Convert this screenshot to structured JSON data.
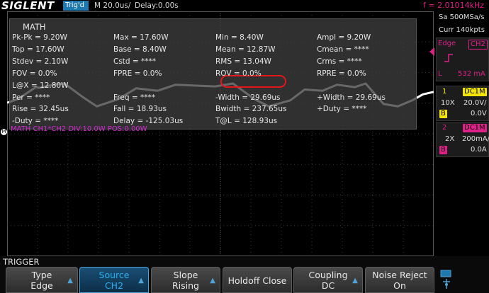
{
  "topbar": {
    "brand": "SIGLENT",
    "trigger_state": "Trig'd",
    "timebase": "M 20.0us/",
    "delay": "Delay:0.00s",
    "frequency": "f = 2.01014kHz"
  },
  "measurements": {
    "title": "MATH",
    "col1": [
      "Pk-Pk = 9.20W",
      "Top = 17.60W",
      "Stdev = 2.10W",
      "FOV = 0.0%",
      "L@X = 12.80W",
      "Per = ****",
      "Rise = 32.45us",
      "-Duty = ****"
    ],
    "col2": [
      "Max = 17.60W",
      "Base = 8.40W",
      "Cstd = ****",
      "FPRE = 0.0%",
      "",
      "Freq = ****",
      "Fall = 18.93us",
      "Delay = -125.03us"
    ],
    "col3": [
      "Min = 8.40W",
      "Mean = 12.87W",
      "RMS = 13.04W",
      "ROV = 0.0%",
      "",
      "-Width = 29.69us",
      "Bwidth = 237.65us",
      "T@L = 128.93us"
    ],
    "col4": [
      "Ampl = 9.20W",
      "Cmean = ****",
      "Crms = ****",
      "RPRE = 0.0%",
      "",
      "+Width = 29.69us",
      "+Duty = ****",
      ""
    ]
  },
  "math_label": "MATH  CH1*CH2  DIV:10.0W  POS:0.00W",
  "right_panel": {
    "sample_rate": "Sa 500MSa/s",
    "memory": "Curr 140kpts",
    "trigger": {
      "type": "Edge",
      "source": "CH2",
      "level_prefix": "L",
      "level": "532 mA"
    },
    "ch1": {
      "number": "1",
      "coupling": "DC1M",
      "probe": "10X",
      "scale": "20.0V/",
      "bw": "B",
      "offset": "0.0V"
    },
    "ch2": {
      "number": "2",
      "coupling": "DC1M",
      "probe": "2X",
      "scale": "200mA/",
      "bw": "B",
      "offset": "0.0A"
    }
  },
  "menu": {
    "title": "TRIGGER",
    "buttons": [
      {
        "line1": "Type",
        "line2": "Edge"
      },
      {
        "line1": "Source",
        "line2": "CH2"
      },
      {
        "line1": "Slope",
        "line2": "Rising"
      },
      {
        "line1": "Holdoff Close",
        "line2": ""
      },
      {
        "line1": "Coupling",
        "line2": "DC"
      },
      {
        "line1": "Noise Reject",
        "line2": "On"
      }
    ]
  },
  "colors": {
    "math": "#d828d8",
    "ch1": "#f5e400",
    "ch2": "#e0208a",
    "accent": "#2cb0f0",
    "highlight": "#e5161a"
  },
  "waveform": {
    "points": [
      [
        0,
        0.2
      ],
      [
        0.03,
        0.35
      ],
      [
        0.08,
        0.85
      ],
      [
        0.09,
        0.82
      ],
      [
        0.13,
        0.95
      ],
      [
        0.16,
        1.0
      ],
      [
        0.21,
        0.45
      ],
      [
        0.25,
        0.05
      ],
      [
        0.31,
        0.35
      ],
      [
        0.36,
        0.8
      ],
      [
        0.42,
        0.7
      ],
      [
        0.47,
        0.95
      ],
      [
        0.58,
        0.88
      ],
      [
        0.63,
        1.0
      ],
      [
        0.69,
        0.35
      ],
      [
        0.73,
        0.05
      ],
      [
        0.79,
        0.3
      ],
      [
        0.83,
        0.75
      ],
      [
        0.88,
        0.7
      ],
      [
        0.92,
        0.95
      ],
      [
        0.97,
        0.85
      ],
      [
        1.0,
        1.0
      ],
      [
        1.05,
        0.15
      ],
      [
        1.09,
        0.05
      ],
      [
        1.13,
        0.3
      ],
      [
        1.16,
        0.55
      ],
      [
        1.19,
        0.65
      ]
    ]
  }
}
